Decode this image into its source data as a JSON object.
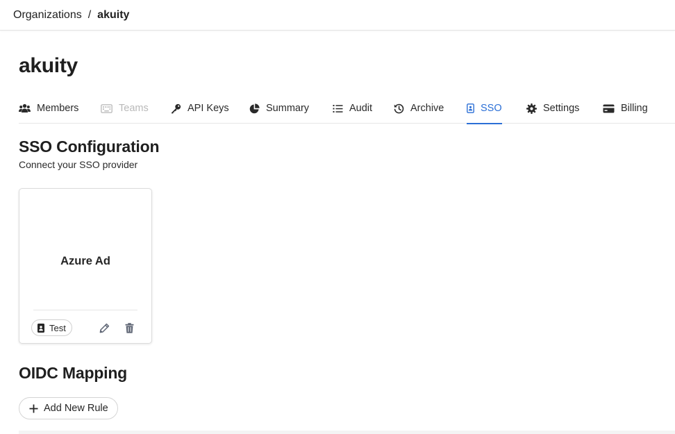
{
  "breadcrumb": {
    "parent": "Organizations",
    "separator": "/",
    "current": "akuity"
  },
  "page_title": "akuity",
  "tabs": [
    {
      "label": "Members",
      "icon": "users-icon",
      "state": "normal"
    },
    {
      "label": "Teams",
      "icon": "keyboard-icon",
      "state": "disabled"
    },
    {
      "label": "API Keys",
      "icon": "key-icon",
      "state": "normal"
    },
    {
      "label": "Summary",
      "icon": "pie-chart-icon",
      "state": "normal"
    },
    {
      "label": "Audit",
      "icon": "list-icon",
      "state": "normal"
    },
    {
      "label": "Archive",
      "icon": "history-icon",
      "state": "normal"
    },
    {
      "label": "SSO",
      "icon": "id-badge-icon",
      "state": "active"
    },
    {
      "label": "Settings",
      "icon": "gear-icon",
      "state": "normal"
    },
    {
      "label": "Billing",
      "icon": "credit-card-icon",
      "state": "normal"
    }
  ],
  "sso": {
    "title": "SSO Configuration",
    "subtitle": "Connect your SSO provider",
    "card": {
      "name": "Azure Ad",
      "test_label": "Test",
      "test_icon": "id-badge-icon",
      "edit_icon": "pencil-icon",
      "delete_icon": "trash-icon"
    }
  },
  "oidc": {
    "title": "OIDC Mapping",
    "add_label": "Add New Rule",
    "add_icon": "plus-icon"
  },
  "colors": {
    "accent": "#2b6fd6",
    "text": "#1f1f1f",
    "muted_icon": "#5f6675",
    "disabled": "#b9b9b9"
  }
}
